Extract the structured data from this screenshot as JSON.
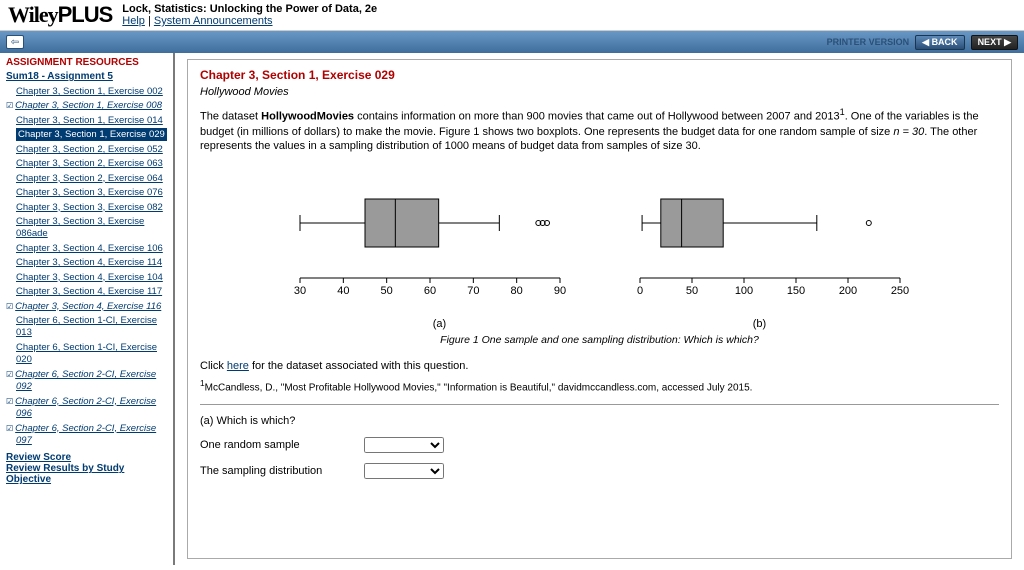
{
  "header": {
    "logo_a": "Wiley",
    "logo_b": "PLUS",
    "book_title": "Lock, Statistics: Unlocking the Power of Data, 2e",
    "help": "Help",
    "sys_ann": "System Announcements"
  },
  "toolbar": {
    "printer": "PRINTER VERSION",
    "back": "◀ BACK",
    "next": "NEXT ▶"
  },
  "sidebar": {
    "group": "ASSIGNMENT RESOURCES",
    "assignment": "Sum18 - Assignment 5",
    "items": [
      {
        "label": "Chapter 3, Section 1, Exercise 002"
      },
      {
        "label": "Chapter 3, Section 1, Exercise 008",
        "checked": true,
        "em": true
      },
      {
        "label": "Chapter 3, Section 1, Exercise 014"
      },
      {
        "label": "Chapter 3, Section 1, Exercise 029",
        "current": true
      },
      {
        "label": "Chapter 3, Section 2, Exercise 052"
      },
      {
        "label": "Chapter 3, Section 2, Exercise 063"
      },
      {
        "label": "Chapter 3, Section 2, Exercise 064"
      },
      {
        "label": "Chapter 3, Section 3, Exercise 076"
      },
      {
        "label": "Chapter 3, Section 3, Exercise 082"
      },
      {
        "label": "Chapter 3, Section 3, Exercise 086ade"
      },
      {
        "label": "Chapter 3, Section 4, Exercise 106"
      },
      {
        "label": "Chapter 3, Section 4, Exercise 114"
      },
      {
        "label": "Chapter 3, Section 4, Exercise 104"
      },
      {
        "label": "Chapter 3, Section 4, Exercise 117"
      },
      {
        "label": "Chapter 3, Section 4, Exercise 116",
        "checked": true,
        "em": true
      },
      {
        "label": "Chapter 6, Section 1-CI, Exercise 013"
      },
      {
        "label": "Chapter 6, Section 1-CI, Exercise 020"
      },
      {
        "label": "Chapter 6, Section 2-CI, Exercise 092",
        "checked": true,
        "em": true
      },
      {
        "label": "Chapter 6, Section 2-CI, Exercise 096",
        "checked": true,
        "em": true
      },
      {
        "label": "Chapter 6, Section 2-CI, Exercise 097",
        "checked": true,
        "em": true
      }
    ],
    "review_score": "Review Score",
    "review_results": "Review Results by Study Objective"
  },
  "exercise": {
    "title": "Chapter 3, Section 1, Exercise 029",
    "subtitle": "Hollywood Movies",
    "p1a": "The dataset ",
    "p1b": "HollywoodMovies",
    "p1c": " contains information on more than 900 movies that came out of Hollywood between 2007 and 2013",
    "p1d": ". One of the variables is the budget (in millions of dollars) to make the movie. Figure 1 shows two boxplots. One represents the budget data for one random sample of size ",
    "p1e": "n = 30",
    "p1f": ". The other represents the values in a sampling distribution of 1000 means of budget data from samples of size 30.",
    "sup": "1",
    "fig_caption": "Figure 1 One sample and one sampling distribution: Which is which?",
    "label_a": "(a)",
    "label_b": "(b)",
    "click_text": "Click ",
    "here": "here",
    "click_text2": " for the dataset associated with this question.",
    "footnote": "McCandless, D., \"Most Profitable Hollywood Movies,\" \"Information is Beautiful,\" davidmccandless.com, accessed July 2015.",
    "qa": "(a) Which is which?",
    "row1": "One random sample",
    "row2": "The sampling distribution"
  },
  "chart_data": [
    {
      "type": "boxplot",
      "label": "(a)",
      "axis_ticks": [
        30,
        40,
        50,
        60,
        70,
        80,
        90
      ],
      "min": 30,
      "q1": 45,
      "median": 52,
      "q3": 62,
      "max": 76,
      "outliers": [
        85,
        86,
        87
      ]
    },
    {
      "type": "boxplot",
      "label": "(b)",
      "axis_ticks": [
        0,
        50,
        100,
        150,
        200,
        250
      ],
      "min": 2,
      "q1": 20,
      "median": 40,
      "q3": 80,
      "max": 170,
      "outliers": [
        220
      ]
    }
  ]
}
